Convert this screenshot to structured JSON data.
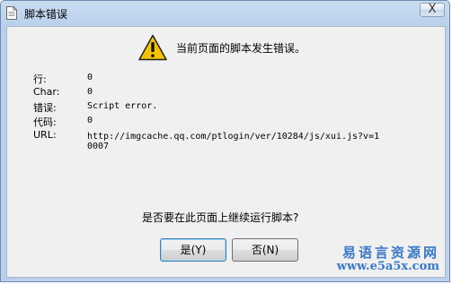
{
  "window": {
    "title": "脚本错误",
    "close_glyph": "X"
  },
  "message": {
    "headline": "当前页面的脚本发生错误。"
  },
  "details": [
    {
      "label": "行:",
      "value": "0"
    },
    {
      "label": "Char:",
      "value": "0"
    },
    {
      "label": "错误:",
      "value": "Script error."
    },
    {
      "label": "代码:",
      "value": "0"
    },
    {
      "label": "URL:",
      "value": "http://imgcache.qq.com/ptlogin/ver/10284/js/xui.js?v=10007"
    }
  ],
  "question": "是否要在此页面上继续运行脚本?",
  "buttons": {
    "yes": "是(Y)",
    "no": "否(N)"
  },
  "watermark": {
    "line1": "易语言资源网",
    "line2": "www.e5a5x.com"
  },
  "colors": {
    "titlebar": "#b9d0ec",
    "client": "#f0f0f0",
    "warning": "#f5c400",
    "watermark": "#3a78c8"
  },
  "icons": {
    "app": "document-icon",
    "message": "warning-icon",
    "close": "close-icon"
  }
}
